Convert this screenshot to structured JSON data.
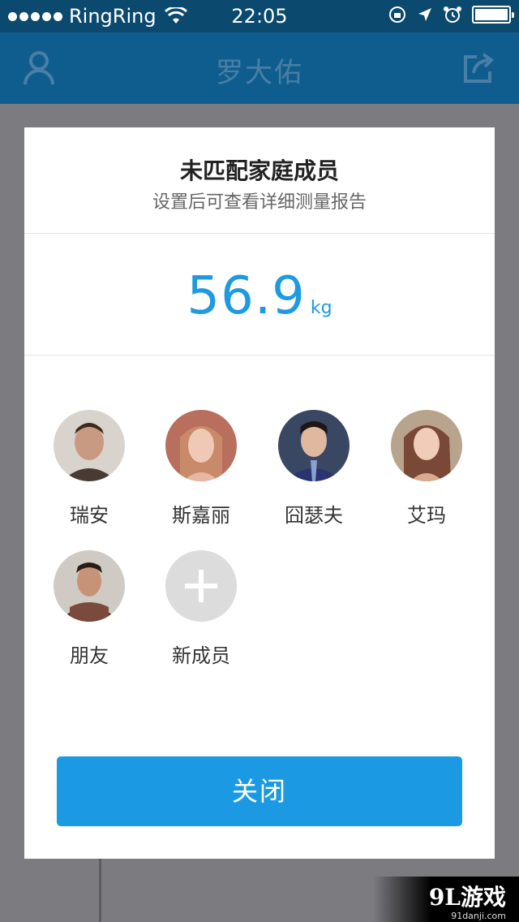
{
  "status_bar": {
    "carrier": "RingRing",
    "time": "22:05"
  },
  "nav": {
    "title": "罗大佑",
    "profile_icon": "person-icon",
    "share_icon": "share-icon"
  },
  "modal": {
    "title": "未匹配家庭成员",
    "subtitle": "设置后可查看详细测量报告",
    "weight": {
      "value": "56.9",
      "unit": "kg"
    },
    "members": [
      {
        "name": "瑞安",
        "avatar_color": "#6b4a3a"
      },
      {
        "name": "斯嘉丽",
        "avatar_color": "#b98276"
      },
      {
        "name": "囧瑟夫",
        "avatar_color": "#2e3a5a"
      },
      {
        "name": "艾玛",
        "avatar_color": "#9b6a58"
      },
      {
        "name": "朋友",
        "avatar_color": "#5a3b36"
      }
    ],
    "add_member_label": "新成员",
    "close_label": "关闭"
  },
  "watermark": {
    "brand": "9L游戏",
    "site": "91danji.com"
  },
  "colors": {
    "accent": "#1b9ae3",
    "status_bar": "#0b4a6e",
    "nav_bar": "#0f5d8f"
  }
}
